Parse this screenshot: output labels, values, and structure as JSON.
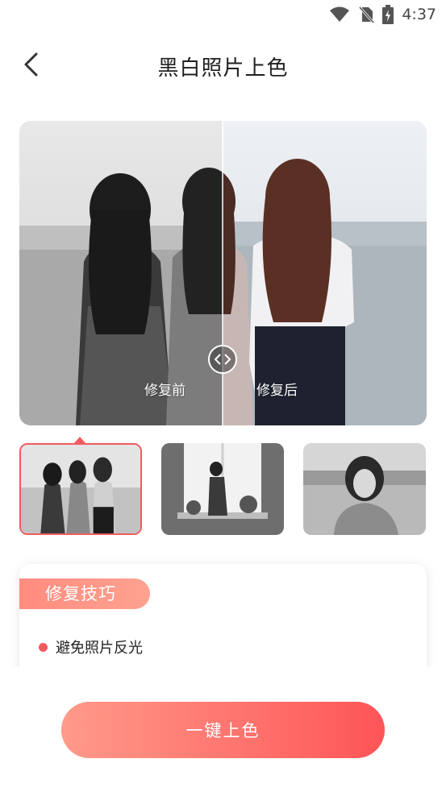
{
  "status_bar": {
    "time": "4:37",
    "icons": [
      "wifi-icon",
      "no-sim-icon",
      "battery-charging-icon"
    ]
  },
  "header": {
    "title": "黑白照片上色",
    "back_icon": "chevron-left-icon"
  },
  "preview": {
    "label_before": "修复前",
    "label_after": "修复后",
    "handle_icon": "compare-arrows-icon"
  },
  "samples": {
    "selected_index": 0,
    "items": [
      "three-women-beach-photo",
      "girl-window-photo",
      "girl-portrait-photo"
    ]
  },
  "tips": {
    "title": "修复技巧",
    "items": [
      "避免照片反光"
    ]
  },
  "action": {
    "colorize_label": "一键上色"
  },
  "colors": {
    "accent": "#fe5557",
    "accent_light": "#ff9a8a",
    "tip_dot": "#f25a5e"
  }
}
